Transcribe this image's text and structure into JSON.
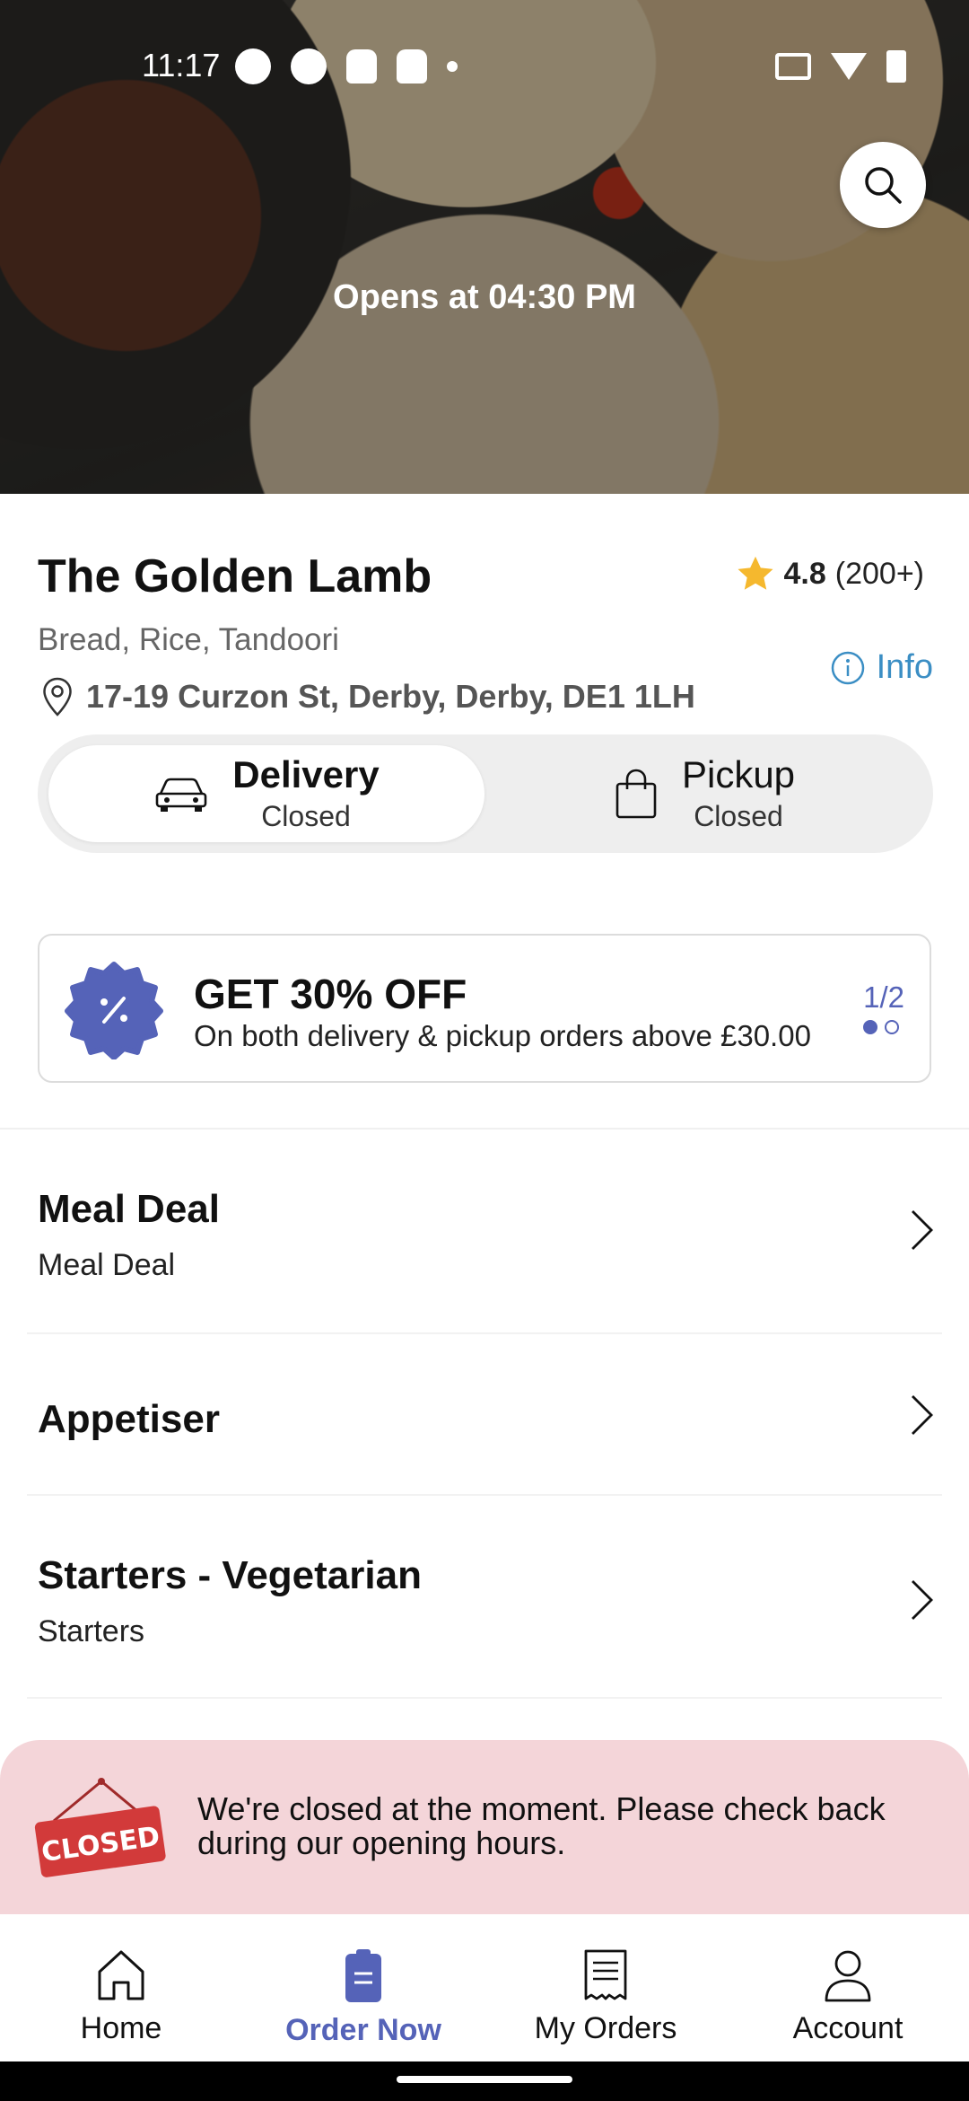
{
  "status_bar": {
    "time": "11:17"
  },
  "hero": {
    "opens_text": "Opens at 04:30 PM"
  },
  "restaurant": {
    "name": "The Golden Lamb",
    "rating": "4.8",
    "rating_count": "(200+)",
    "cuisines": "Bread, Rice, Tandoori",
    "address": "17-19 Curzon St, Derby, Derby, DE1 1LH",
    "info_label": "Info"
  },
  "modes": [
    {
      "label": "Delivery",
      "status": "Closed"
    },
    {
      "label": "Pickup",
      "status": "Closed"
    }
  ],
  "promo": {
    "title": "GET 30% OFF",
    "description": "On both delivery & pickup orders above £30.00",
    "page": "1/2"
  },
  "menu": [
    {
      "title": "Meal Deal",
      "subtitle": "Meal Deal"
    },
    {
      "title": "Appetiser",
      "subtitle": ""
    },
    {
      "title": "Starters - Vegetarian",
      "subtitle": "Starters"
    }
  ],
  "closed_banner": {
    "sign_text": "CLOSED",
    "message": "We're closed at the moment. Please check back during our opening hours."
  },
  "nav": [
    {
      "label": "Home",
      "icon": "home-icon"
    },
    {
      "label": "Order Now",
      "icon": "order-icon"
    },
    {
      "label": "My Orders",
      "icon": "receipt-icon"
    },
    {
      "label": "Account",
      "icon": "person-icon"
    }
  ],
  "colors": {
    "accent": "#5563b8",
    "info_blue": "#3b8ec4",
    "star": "#f5b82e",
    "closed_bg": "#f4d5d9",
    "closed_sign": "#d23a3a"
  }
}
